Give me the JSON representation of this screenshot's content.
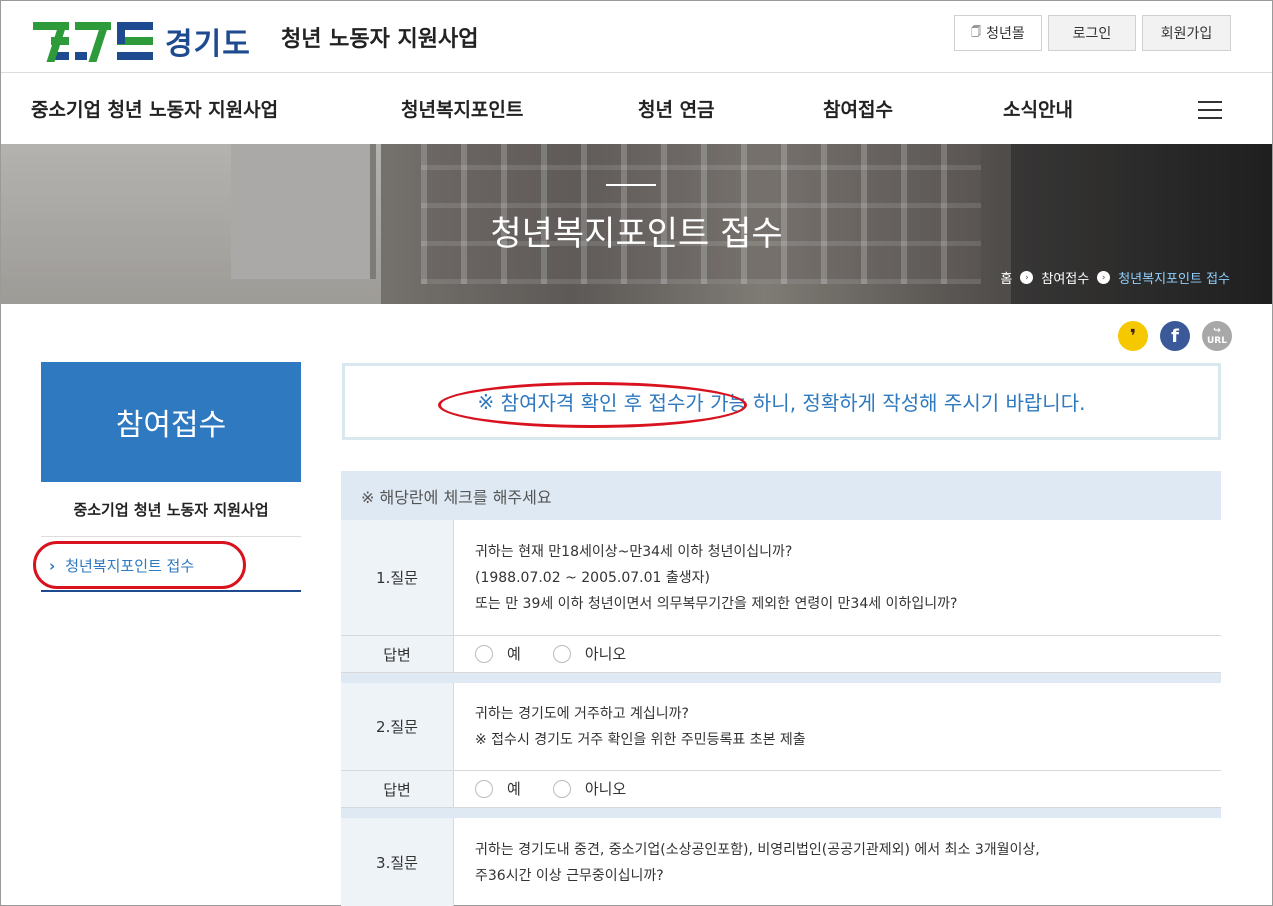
{
  "header": {
    "logo_text": "경기도",
    "site_title": "청년 노동자 지원사업",
    "utility": {
      "mall": "청년몰",
      "login": "로그인",
      "join": "회원가입"
    },
    "logo_colors": {
      "green": "#2e9b3a",
      "blue": "#1e4a8f"
    }
  },
  "nav": {
    "items": [
      "중소기업 청년 노동자 지원사업",
      "청년복지포인트",
      "청년 연금",
      "참여접수",
      "소식안내"
    ]
  },
  "hero": {
    "title": "청년복지포인트 접수",
    "breadcrumb": {
      "home": "홈",
      "section": "참여접수",
      "current": "청년복지포인트 접수"
    }
  },
  "share": {
    "kakao": "❜",
    "facebook": "f",
    "url": "URL"
  },
  "sidebar": {
    "title": "참여접수",
    "subtitle": "중소기업 청년 노동자 지원사업",
    "link": "청년복지포인트 접수",
    "accent": "#2e79bf"
  },
  "notice": {
    "prefix": "※ ",
    "highlight": "참여자격 확인 후 접수가 가능",
    "suffix": "하니, 정확하게 작성해 주시기 바랍니다."
  },
  "form": {
    "header": "※ 해당란에 체크를 해주세요",
    "answer_label": "답변",
    "yes": "예",
    "no": "아니오",
    "questions": [
      {
        "label": "1.질문",
        "lines": [
          "귀하는 현재 만18세이상~만34세 이하 청년이십니까?",
          "(1988.07.02 ~ 2005.07.01 출생자)",
          "또는 만 39세 이하 청년이면서 의무복무기간을 제외한 연령이 만34세 이하입니까?"
        ]
      },
      {
        "label": "2.질문",
        "lines": [
          "귀하는 경기도에 거주하고 계십니까?",
          "※ 접수시 경기도 거주 확인을 위한 주민등록표 초본 제출"
        ]
      },
      {
        "label": "3.질문",
        "lines": [
          "귀하는 경기도내 중견, 중소기업(소상공인포함), 비영리법인(공공기관제외) 에서 최소 3개월이상,",
          "주36시간 이상 근무중이십니까?"
        ]
      }
    ]
  }
}
